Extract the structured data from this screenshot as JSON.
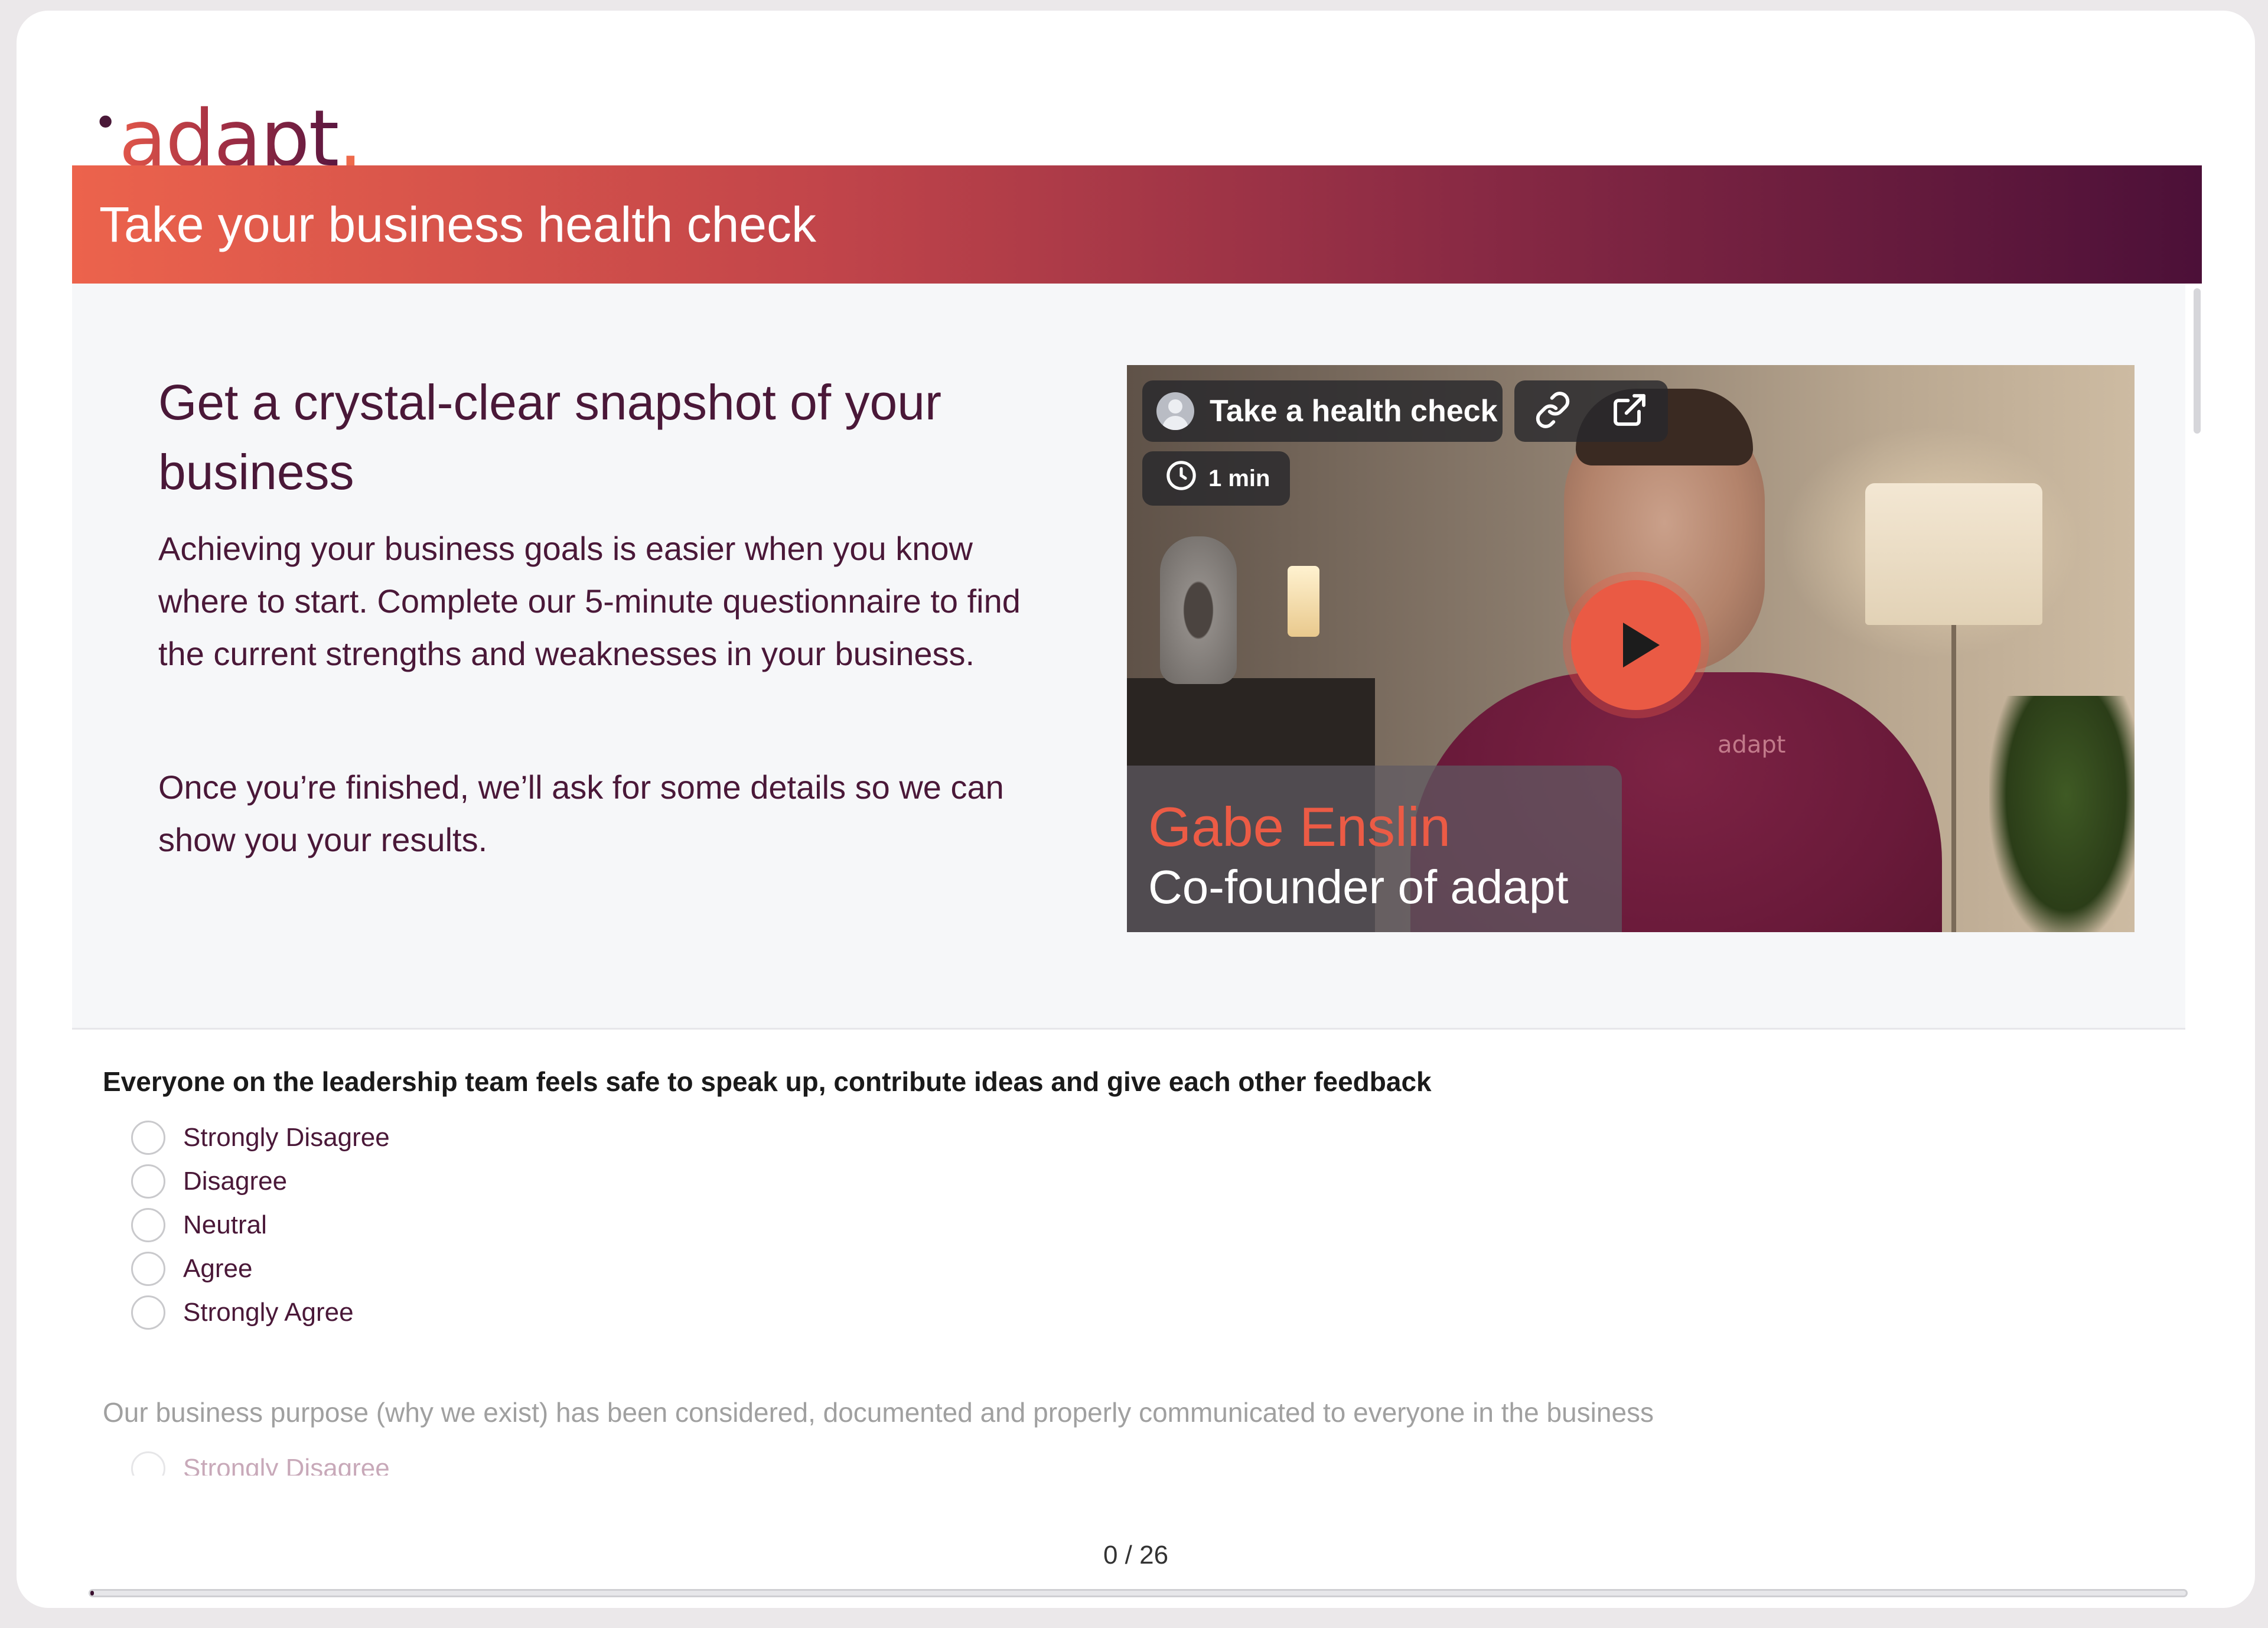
{
  "brand": {
    "logo_text": "adapt",
    "accent_color": "#ea5a44",
    "primary_color": "#4a1838"
  },
  "banner": {
    "title": "Take your business health check"
  },
  "intro": {
    "heading": "Get a crystal-clear snapshot of your business",
    "paragraph1": "Achieving your business goals is easier when you know where to start. Complete our 5-minute questionnaire to find the current strengths and weaknesses in your business.",
    "paragraph2": "Once you’re finished, we’ll ask for some details so we can show you your results."
  },
  "video": {
    "title": "Take a health check",
    "duration": "1 min",
    "presenter_name": "Gabe Enslin",
    "presenter_role": "Co-founder of adapt",
    "shirt_logo": "adapt",
    "icons": [
      "avatar-icon",
      "link-icon",
      "external-link-icon",
      "clock-icon",
      "play-icon"
    ]
  },
  "questions": [
    {
      "text": "Everyone on the leadership team feels safe to speak up, contribute ideas and give each other feedback",
      "options": [
        "Strongly Disagree",
        "Disagree",
        "Neutral",
        "Agree",
        "Strongly Agree"
      ]
    },
    {
      "text": "Our business purpose (why we exist) has been considered, documented and properly communicated to everyone in the business",
      "options": [
        "Strongly Disagree"
      ]
    }
  ],
  "progress": {
    "label": "0 / 26",
    "answered": 0,
    "total": 26
  }
}
